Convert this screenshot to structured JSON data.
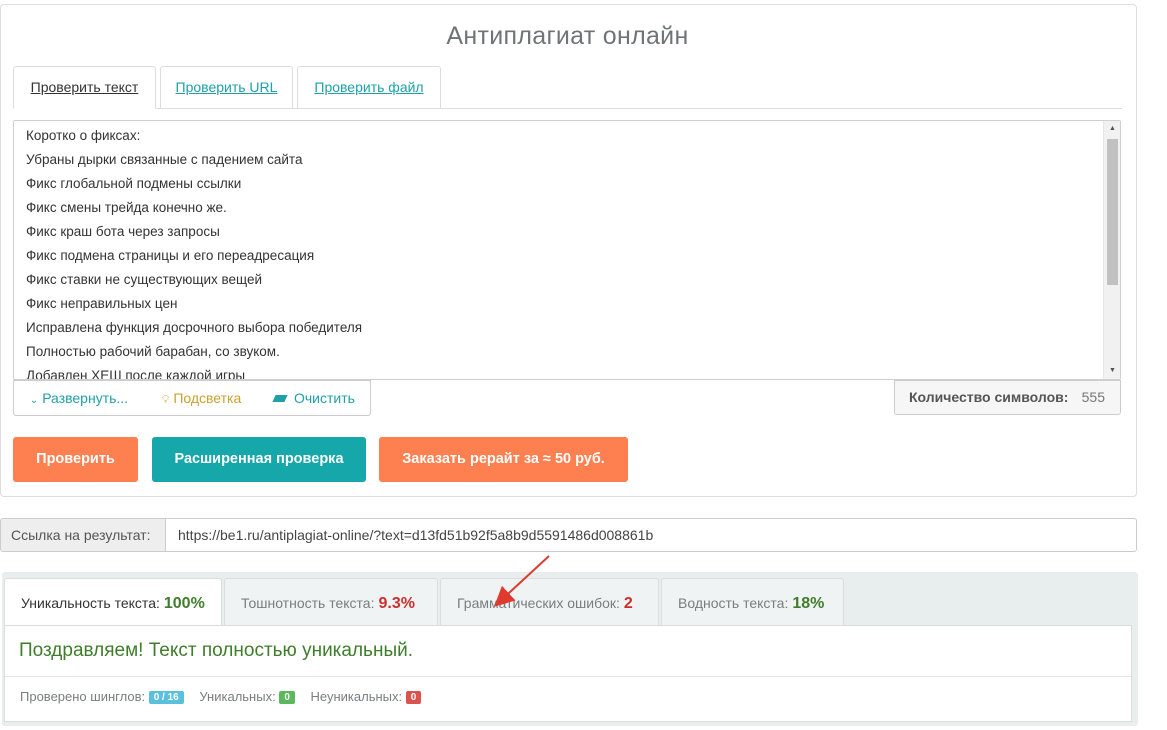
{
  "app": {
    "title": "Антиплагиат онлайн"
  },
  "tabs": [
    {
      "label": "Проверить текст",
      "active": true
    },
    {
      "label": "Проверить URL",
      "active": false
    },
    {
      "label": "Проверить файл",
      "active": false
    }
  ],
  "editor": {
    "lines": [
      "Коротко о фиксах:",
      "Убраны дырки связанные с падением сайта",
      "Фикс глобальной подмены ссылки",
      "Фикс смены трейда конечно же.",
      "Фикс краш бота через запросы",
      "Фикс подмена страницы и его переадресация",
      "Фикс ставки не существующих вещей",
      "Фикс неправильных цен",
      "Исправлена функция досрочного выбора победителя",
      "Полностью рабочий барабан, со звуком.",
      "Добавлен ХЕШ после каждой игры"
    ]
  },
  "toolbar": {
    "expand_label": "Развернуть...",
    "highlight_label": "Подсветка",
    "clear_label": "Очистить",
    "char_count_label": "Количество символов:",
    "char_count_value": "555"
  },
  "actions": {
    "check_label": "Проверить",
    "extended_label": "Расширенная проверка",
    "rewrite_label": "Заказать рерайт за ≈ 50 руб."
  },
  "result_link": {
    "label": "Ссылка на результат:",
    "url": "https://be1.ru/antiplagiat-online/?text=d13fd51b92f5a8b9d5591486d008861b"
  },
  "result_tabs": [
    {
      "label": "Уникальность текста:",
      "value": "100%",
      "color": "#3f7d2b",
      "active": true
    },
    {
      "label": "Тошнотность текста:",
      "value": "9.3%",
      "color": "#c9302c",
      "active": false
    },
    {
      "label": "Грамматических ошибок:",
      "value": "2",
      "color": "#c9302c",
      "active": false
    },
    {
      "label": "Водность текста:",
      "value": "18%",
      "color": "#3f7d2b",
      "active": false
    }
  ],
  "result": {
    "message": "Поздравляем! Текст полностью уникальный.",
    "shingles_label": "Проверено шинглов:",
    "shingles_value": "0 / 16",
    "unique_label": "Уникальных:",
    "unique_value": "0",
    "nonunique_label": "Неуникальных:",
    "nonunique_value": "0"
  },
  "colors": {
    "accent": "#1fa0a8",
    "orange": "#fe7f4f",
    "teal": "#16a7aa",
    "badge_blue": "#5bc0de",
    "badge_green": "#5cb85c",
    "badge_red": "#d9534f",
    "arrow": "#e03a2e"
  }
}
